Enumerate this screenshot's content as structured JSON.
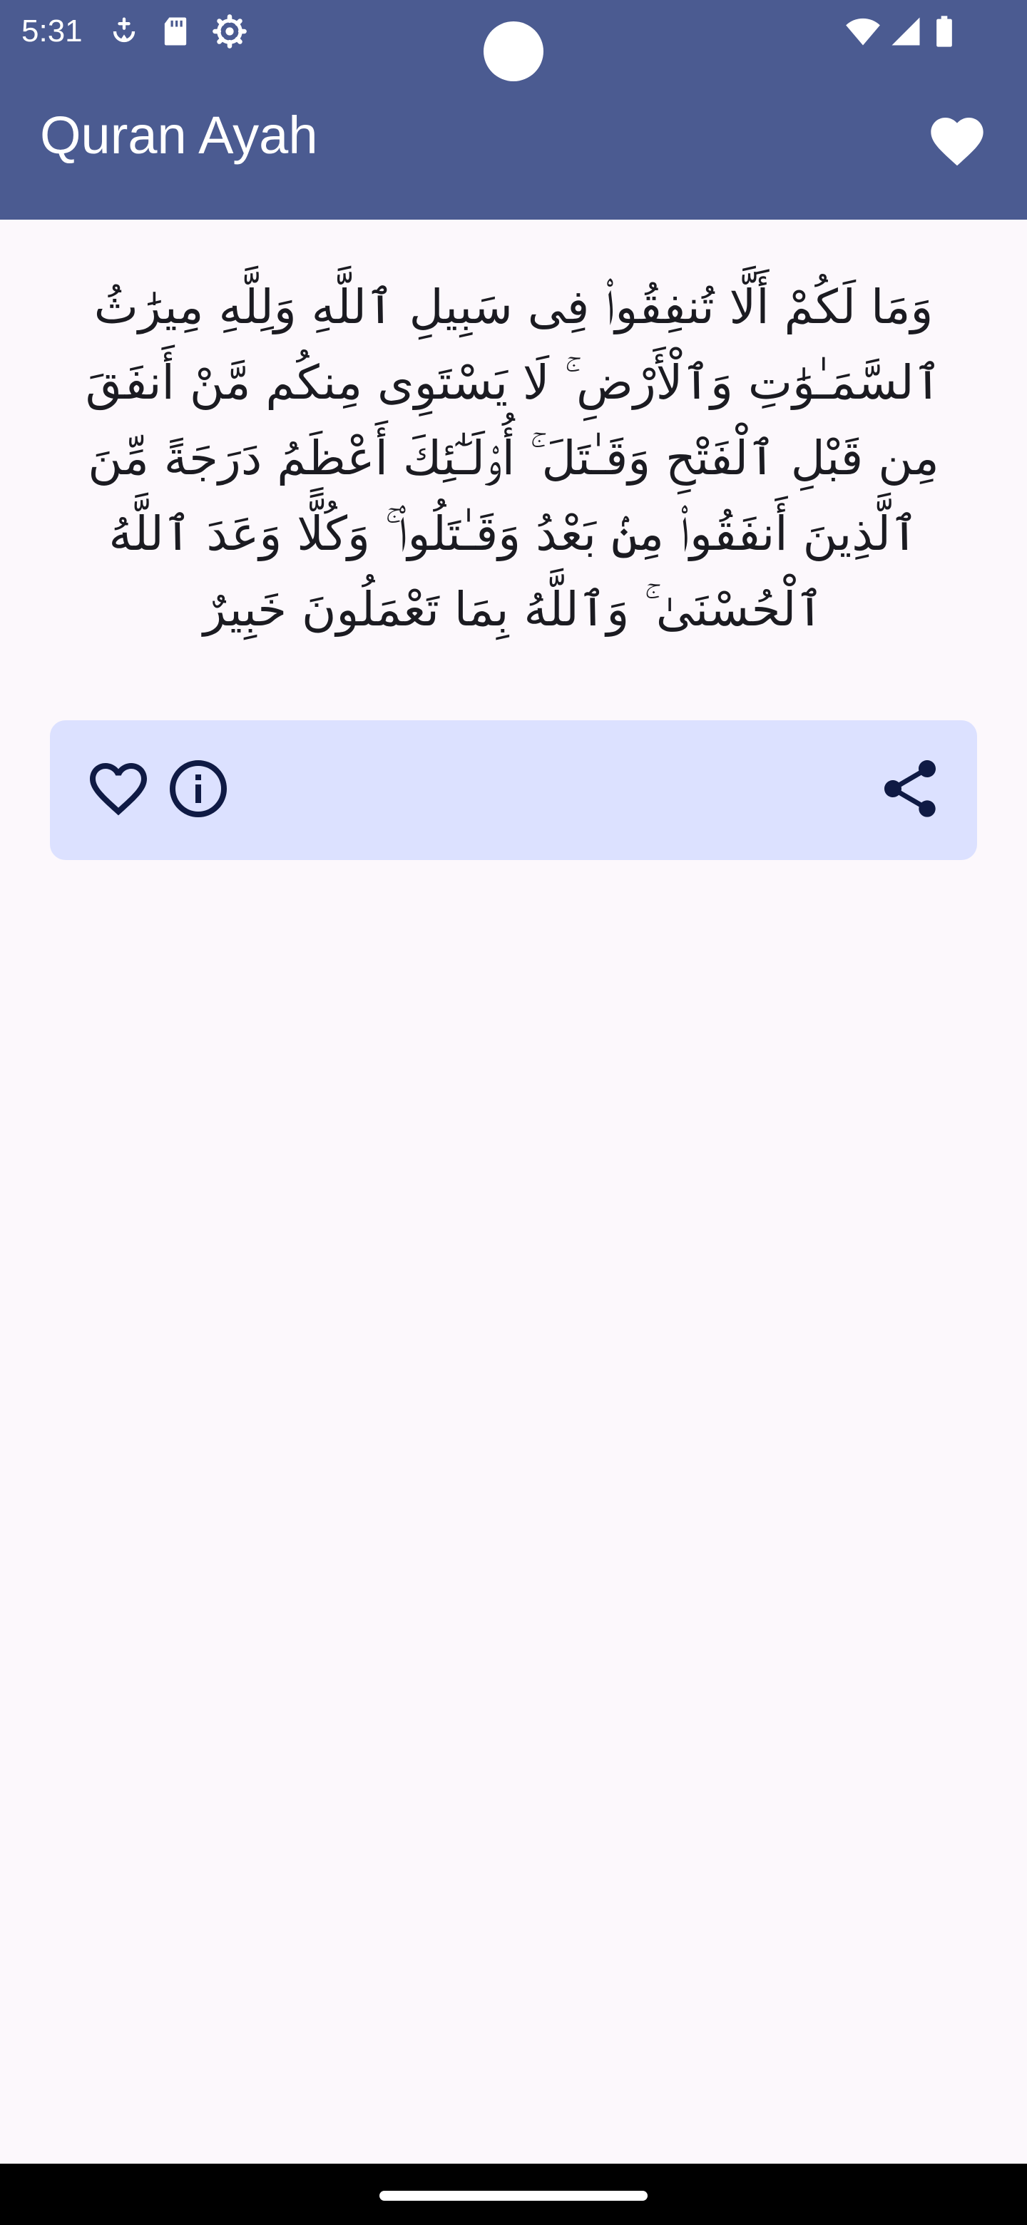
{
  "status_bar": {
    "time": "5:31",
    "left_icons": [
      "data-saver-icon",
      "sd-card-icon",
      "settings-gear-icon"
    ],
    "right_icons": [
      "wifi-icon",
      "cell-signal-icon",
      "battery-icon"
    ]
  },
  "app_bar": {
    "title": "Quran Ayah",
    "action_icon": "heart-filled-icon"
  },
  "ayah": {
    "text": "وَمَا لَكُمْ أَلَّا تُنفِقُوا۟ فِى سَبِيلِ ٱللَّهِ وَلِلَّهِ مِيرَٰثُ ٱلسَّمَـٰوَٰتِ وَٱلْأَرْضِ ۚ لَا يَسْتَوِى مِنكُم مَّنْ أَنفَقَ مِن قَبْلِ ٱلْفَتْحِ وَقَـٰتَلَ ۚ أُو۟لَـٰٓئِكَ أَعْظَمُ دَرَجَةً مِّنَ ٱلَّذِينَ أَنفَقُوا۟ مِنۢ بَعْدُ وَقَـٰتَلُوا۟ ۚ وَكُلًّا وَعَدَ ٱللَّهُ ٱلْحُسْنَىٰ ۚ وَٱللَّهُ بِمَا تَعْمَلُونَ خَبِيرٌ"
  },
  "action_card": {
    "icons": [
      "heart-outline-icon",
      "info-icon",
      "share-icon"
    ]
  },
  "colors": {
    "primary": "#4b5b91",
    "background": "#fcf8fc",
    "card": "#dce1ff",
    "on_card": "#0f1a44",
    "text": "#1b1b21"
  }
}
